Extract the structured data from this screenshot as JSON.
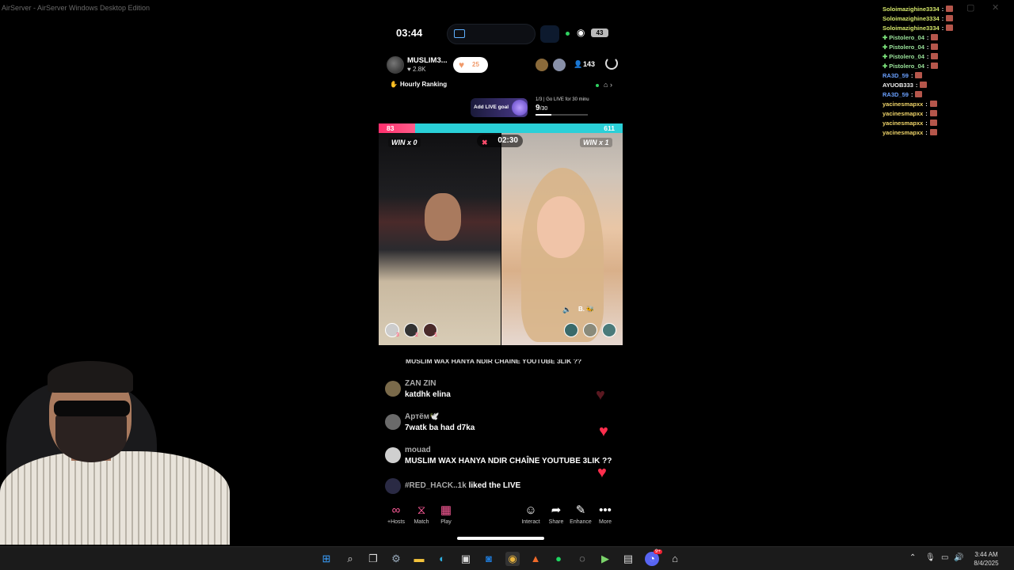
{
  "window": {
    "title": "AirServer - AirServer Windows Desktop Edition"
  },
  "chat": [
    {
      "user": "Soloimazighine3334",
      "sep": ":",
      "style": "nm"
    },
    {
      "user": "Soloimazighine3334",
      "sep": ":",
      "style": "nm"
    },
    {
      "user": "Soloimazighine3334",
      "sep": ":",
      "style": "nm"
    },
    {
      "user": "Pistolero_04",
      "sep": ":",
      "style": "nm p"
    },
    {
      "user": "Pistolero_04",
      "sep": ":",
      "style": "nm p"
    },
    {
      "user": "Pistolero_04",
      "sep": ":",
      "style": "nm p"
    },
    {
      "user": "Pistolero_04",
      "sep": ":",
      "style": "nm p"
    },
    {
      "user": "RA3D_59",
      "sep": ":",
      "style": "nm b"
    },
    {
      "user": "AYUOB333",
      "sep": ":",
      "style": "nm w"
    },
    {
      "user": "RA3D_59",
      "sep": ":",
      "style": "nm b"
    },
    {
      "user": "yacinesmapxx",
      "sep": ":",
      "style": "nm y"
    },
    {
      "user": "yacinesmapxx",
      "sep": ":",
      "style": "nm y"
    },
    {
      "user": "yacinesmapxx",
      "sep": ":",
      "style": "nm y"
    },
    {
      "user": "yacinesmapxx",
      "sep": ":",
      "style": "nm y"
    }
  ],
  "status": {
    "time": "03:44",
    "battery": "43"
  },
  "host": {
    "name": "MUSLIM3...",
    "likes": "2.8K",
    "follow_count": "25",
    "viewers": "143"
  },
  "ranking": {
    "label": "Hourly Ranking"
  },
  "goal": {
    "label": "Add LIVE goal",
    "progress_label": "1/3  |  Go LIVE for 30 minu",
    "count": "9",
    "total": "/30",
    "progress": 0.3
  },
  "battle": {
    "score_left": "83",
    "score_right": "611",
    "win_left": "WIN",
    "win_left_x": "x 0",
    "win_right": "WIN",
    "win_right_x": "x 1",
    "timer": "02:30",
    "right_name": "B. 🐝",
    "gifters": [
      "3",
      "2",
      "1"
    ]
  },
  "comments": {
    "partial": "MUSLIM WAX HANYA NDIR CHAÎNE YOUTUBE 3LIK ??",
    "items": [
      {
        "user": "ZAN ZIN",
        "msg": "katdhk elina"
      },
      {
        "user": "Артём🕊️",
        "msg": "7watk ba had d7ka"
      },
      {
        "user": "mouad",
        "msg": "MUSLIM WAX HANYA NDIR CHAÎNE YOUTUBE 3LIK ??"
      }
    ],
    "liked_user": "#RED_HACK..1k",
    "liked_text": " liked the LIVE"
  },
  "actions": {
    "hosts": "+Hosts",
    "match": "Match",
    "play": "Play",
    "interact": "Interact",
    "share": "Share",
    "enhance": "Enhance",
    "more": "More"
  },
  "taskbar": {
    "time": "3:44 AM",
    "date": "8/4/2025",
    "discord_badge": "9+"
  },
  "colors": {
    "accent_pink": "#ff2f6d",
    "accent_cyan": "#2ad0d8",
    "heart": "#ff2e4d"
  }
}
